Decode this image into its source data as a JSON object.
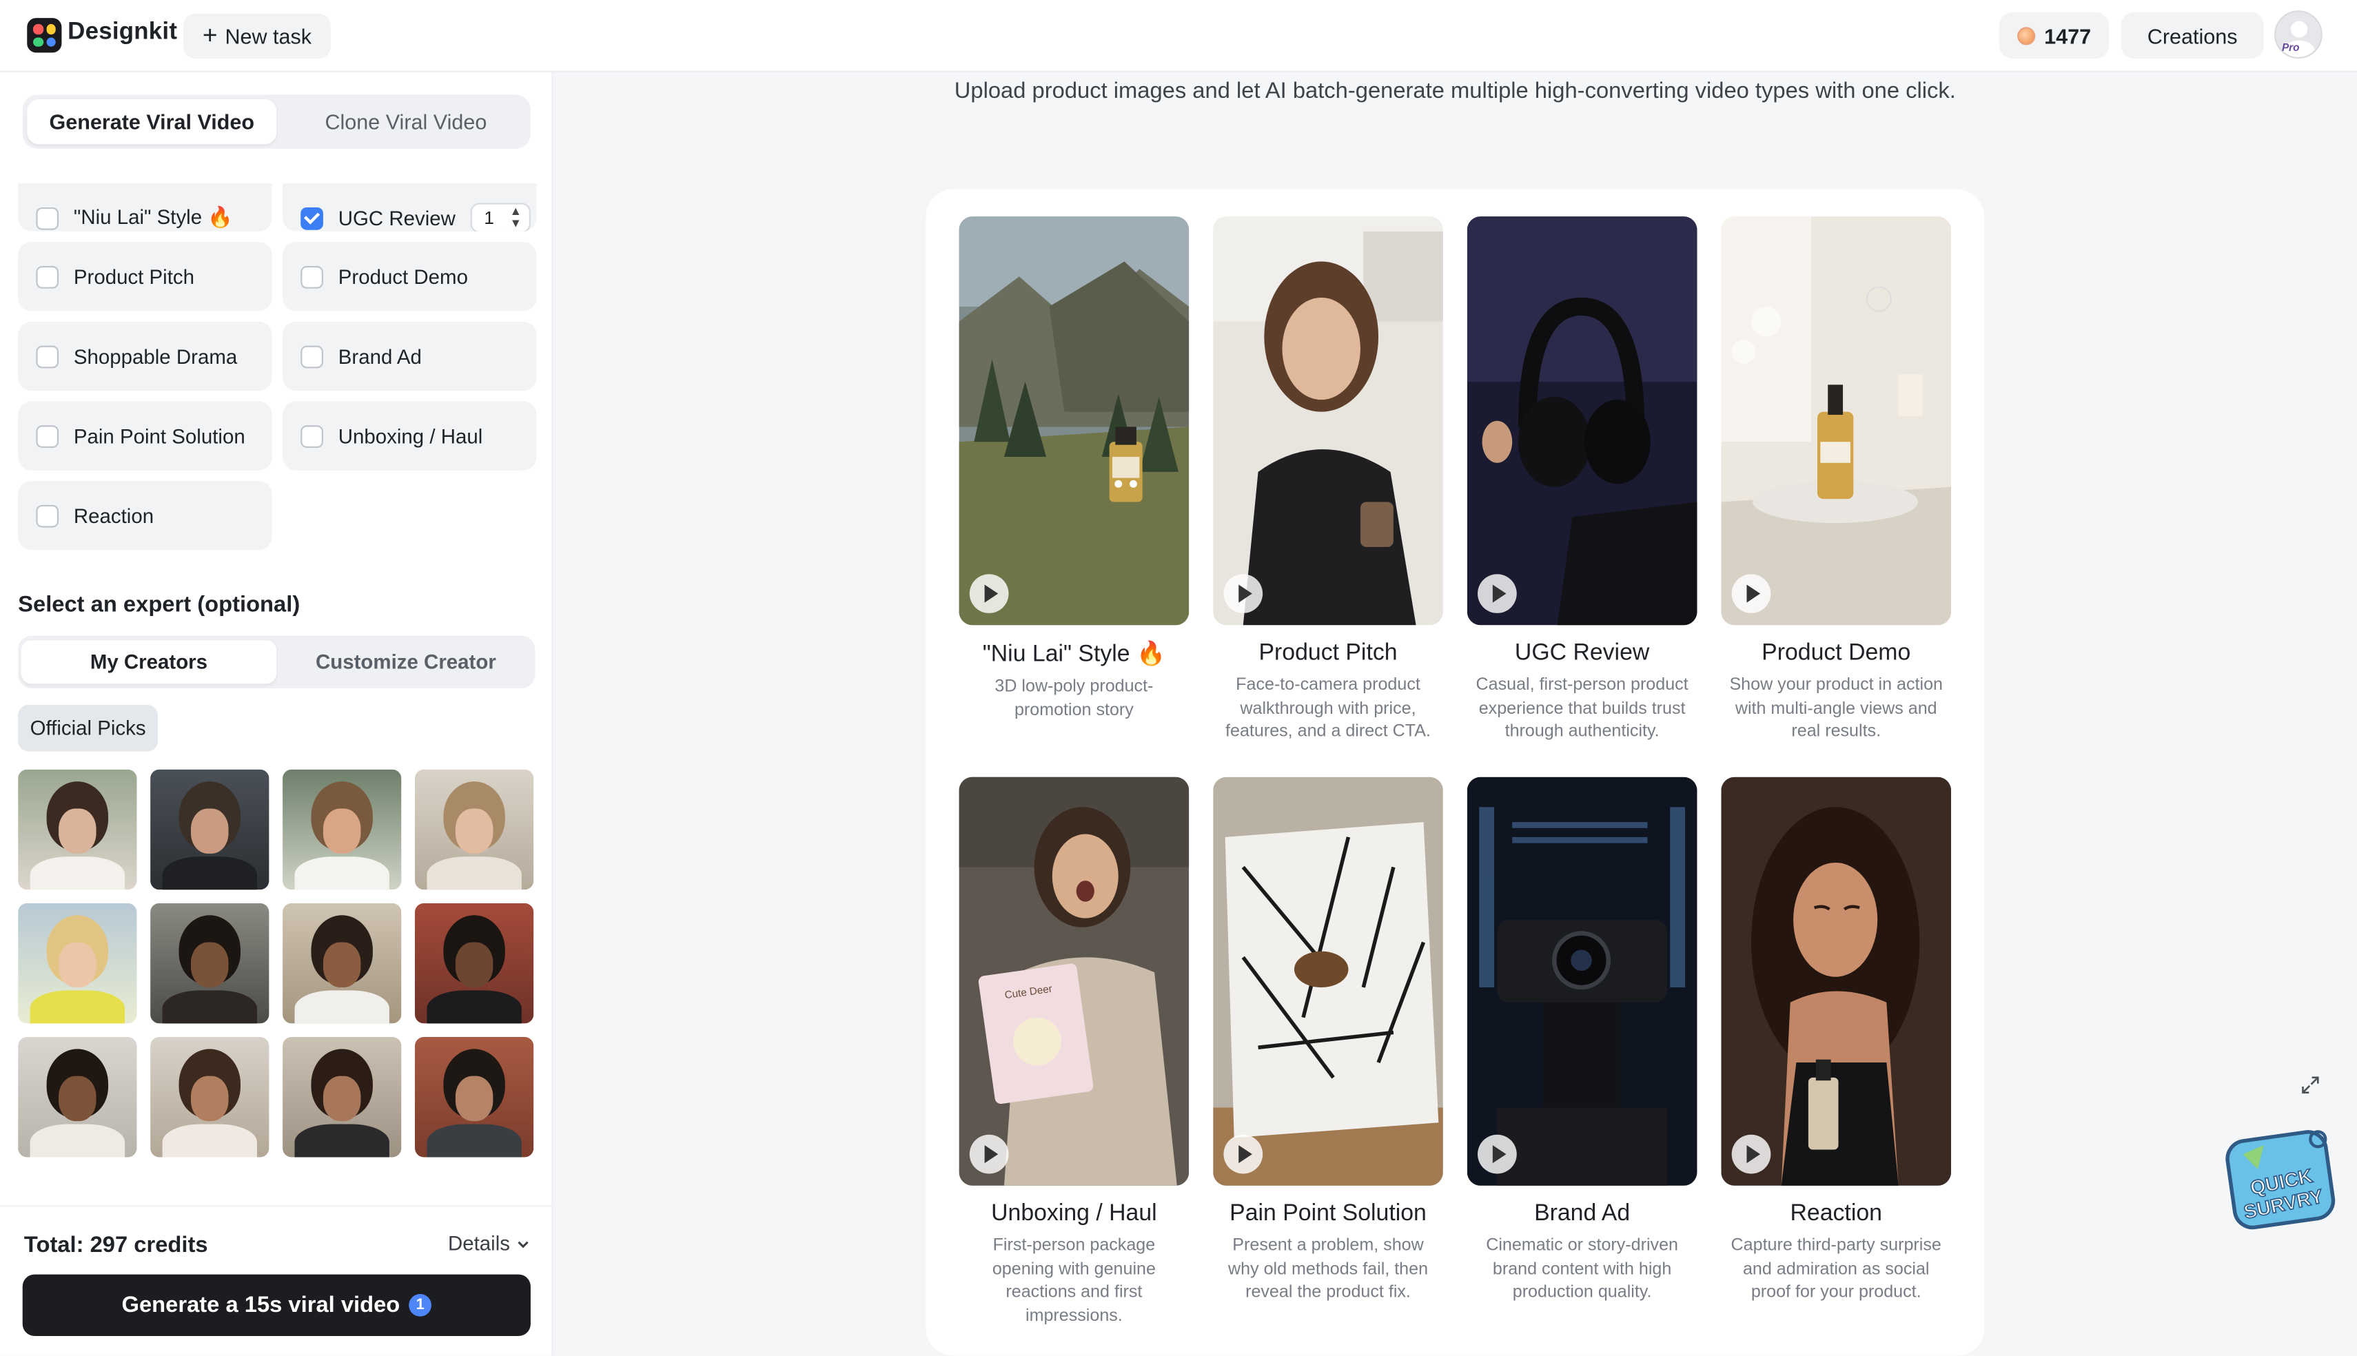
{
  "app": {
    "brand": "Designkit",
    "new_task": "New task",
    "credits": "1477",
    "creations": "Creations",
    "plan_badge": "Pro"
  },
  "sidebar": {
    "mode_tabs": [
      "Generate Viral Video",
      "Clone Viral Video"
    ],
    "video_types": [
      {
        "label": "\"Niu Lai\" Style 🔥",
        "checked": false
      },
      {
        "label": "UGC Review",
        "checked": true,
        "count": "1"
      },
      {
        "label": "Product Pitch",
        "checked": false
      },
      {
        "label": "Product Demo",
        "checked": false
      },
      {
        "label": "Shoppable Drama",
        "checked": false
      },
      {
        "label": "Brand Ad",
        "checked": false
      },
      {
        "label": "Pain Point Solution",
        "checked": false
      },
      {
        "label": "Unboxing / Haul",
        "checked": false
      },
      {
        "label": "Reaction",
        "checked": false
      }
    ],
    "expert_title": "Select an expert (optional)",
    "creator_tabs": [
      "My Creators",
      "Customize Creator"
    ],
    "picks_label": "Official Picks",
    "total": "Total: 297 credits",
    "details": "Details",
    "generate_button": "Generate a 15s viral video",
    "generate_badge": "1"
  },
  "main": {
    "subtitle": "Upload product images and let AI batch-generate multiple high-converting video types with one click.",
    "templates": [
      {
        "title": "\"Niu Lai\" Style 🔥",
        "desc": "3D low-poly product-promotion story"
      },
      {
        "title": "Product Pitch",
        "desc": "Face-to-camera product walkthrough with price, features, and a direct CTA."
      },
      {
        "title": "UGC Review",
        "desc": "Casual, first-person product experience that builds trust through authenticity."
      },
      {
        "title": "Product Demo",
        "desc": "Show your product in action with multi-angle views and real results."
      },
      {
        "title": "Unboxing / Haul",
        "desc": "First-person package opening with genuine reactions and first impressions."
      },
      {
        "title": "Pain Point Solution",
        "desc": "Present a problem, show why old methods fail, then reveal the product fix."
      },
      {
        "title": "Brand Ad",
        "desc": "Cinematic or story-driven brand content with high production quality."
      },
      {
        "title": "Reaction",
        "desc": "Capture third-party surprise and admiration as social proof for your product."
      }
    ],
    "survey_text": "QUICK SURVRY"
  },
  "colors": {
    "accent": "#3b7ef6",
    "primary_button": "#1c1d20",
    "page_bg": "#f5f6f8"
  }
}
